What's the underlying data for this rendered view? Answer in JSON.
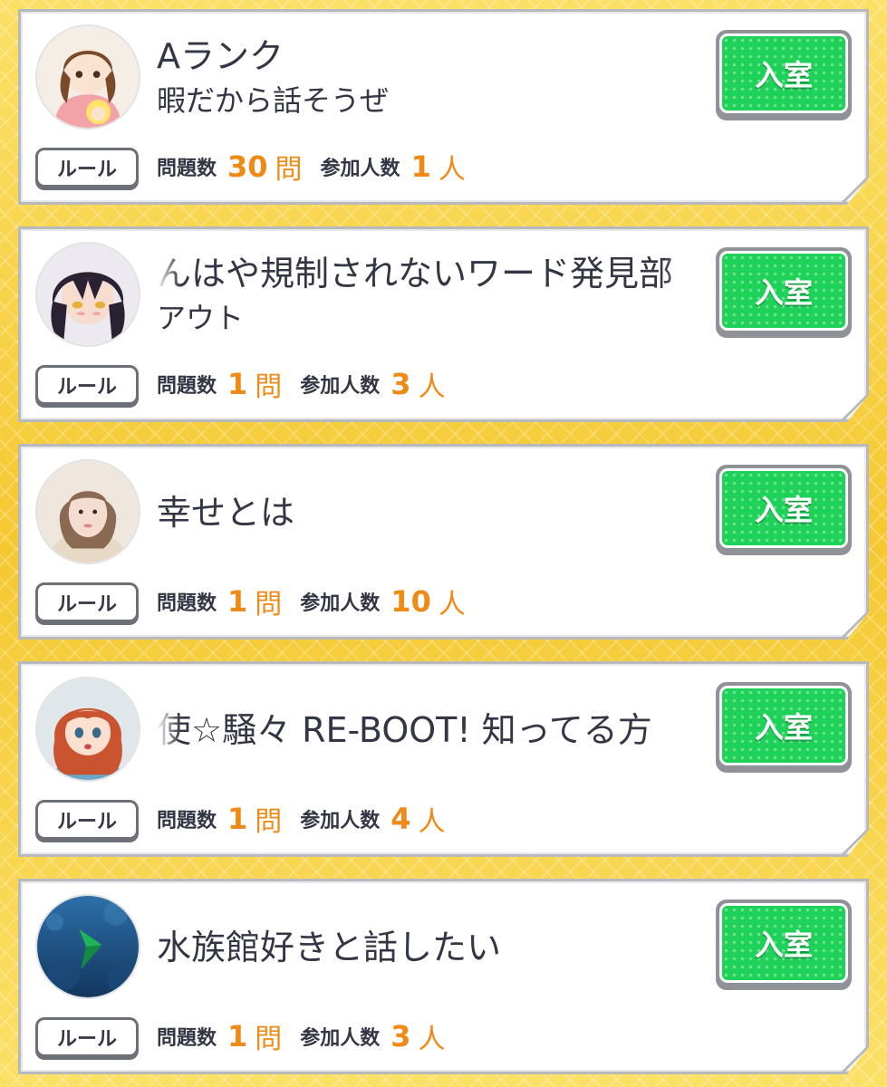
{
  "rooms": [
    {
      "title": "Aランク",
      "subtitle": "暇だから話そうぜ",
      "enter_label": "入室",
      "rule_label": "ルール",
      "questions_label": "問題数",
      "questions_count": "30",
      "questions_unit": "問",
      "participants_label": "参加人数",
      "participants_count": "1",
      "participants_unit": "人"
    },
    {
      "title": "んはや規制されないワード発見部",
      "subtitle": "アウト",
      "enter_label": "入室",
      "rule_label": "ルール",
      "questions_label": "問題数",
      "questions_count": "1",
      "questions_unit": "問",
      "participants_label": "参加人数",
      "participants_count": "3",
      "participants_unit": "人"
    },
    {
      "title": "幸せとは",
      "subtitle": "",
      "enter_label": "入室",
      "rule_label": "ルール",
      "questions_label": "問題数",
      "questions_count": "1",
      "questions_unit": "問",
      "participants_label": "参加人数",
      "participants_count": "10",
      "participants_unit": "人"
    },
    {
      "title": "使☆騒々 RE-BOOT! 知ってる方",
      "subtitle": "",
      "enter_label": "入室",
      "rule_label": "ルール",
      "questions_label": "問題数",
      "questions_count": "1",
      "questions_unit": "問",
      "participants_label": "参加人数",
      "participants_count": "4",
      "participants_unit": "人"
    },
    {
      "title": "水族館好きと話したい",
      "subtitle": "",
      "enter_label": "入室",
      "rule_label": "ルール",
      "questions_label": "問題数",
      "questions_count": "1",
      "questions_unit": "問",
      "participants_label": "参加人数",
      "participants_count": "3",
      "participants_unit": "人"
    }
  ],
  "colors": {
    "accent_orange": "#f08a17",
    "enter_green": "#1ed158",
    "background_yellow": "#f7cf3d",
    "text_dark": "#333644"
  }
}
